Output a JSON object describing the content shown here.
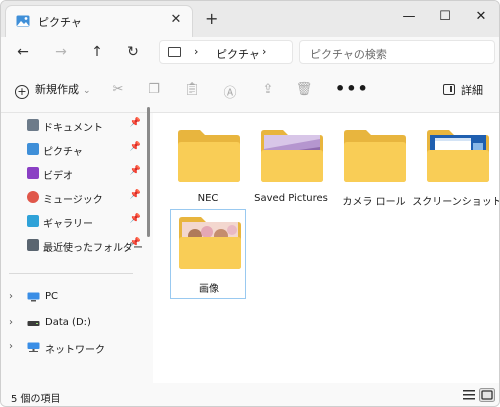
{
  "window": {
    "tab_title": "ピクチャ",
    "tab_close": "✕",
    "new_tab": "+",
    "minimize": "—",
    "maximize": "☐",
    "close": "✕"
  },
  "nav": {
    "back": "←",
    "forward": "→",
    "up": "↑",
    "refresh": "↻",
    "chevron": "›",
    "breadcrumb": "ピクチャ",
    "search_placeholder": "ピクチャの検索"
  },
  "toolbar": {
    "new_label": "新規作成",
    "new_caret": "⌄",
    "more": "•••",
    "details_label": "詳細"
  },
  "sidebar": {
    "pin": "📌",
    "quick_access": [
      {
        "label": "ドキュメント",
        "icon": "documents-icon"
      },
      {
        "label": "ピクチャ",
        "icon": "pictures-icon"
      },
      {
        "label": "ビデオ",
        "icon": "videos-icon"
      },
      {
        "label": "ミュージック",
        "icon": "music-icon"
      },
      {
        "label": "ギャラリー",
        "icon": "gallery-icon"
      },
      {
        "label": "最近使ったフォルダー",
        "icon": "recent-folder-icon"
      }
    ],
    "tree": [
      {
        "label": "PC",
        "icon": "pc-icon"
      },
      {
        "label": "Data (D:)",
        "icon": "drive-icon"
      },
      {
        "label": "ネットワーク",
        "icon": "network-icon"
      }
    ],
    "expand": "›"
  },
  "items": [
    {
      "label": "NEC",
      "thumb": "plain"
    },
    {
      "label": "Saved Pictures",
      "thumb": "lavender"
    },
    {
      "label": "カメラ ロール",
      "thumb": "plain"
    },
    {
      "label": "スクリーンショット",
      "thumb": "screenshot"
    },
    {
      "label": "画像",
      "thumb": "bears",
      "selected": true
    }
  ],
  "status": {
    "count_text": "5 個の項目"
  },
  "colors": {
    "folder_back": "#e8b53e",
    "folder_front": "#f9cd56",
    "accent": "#0067c0"
  }
}
